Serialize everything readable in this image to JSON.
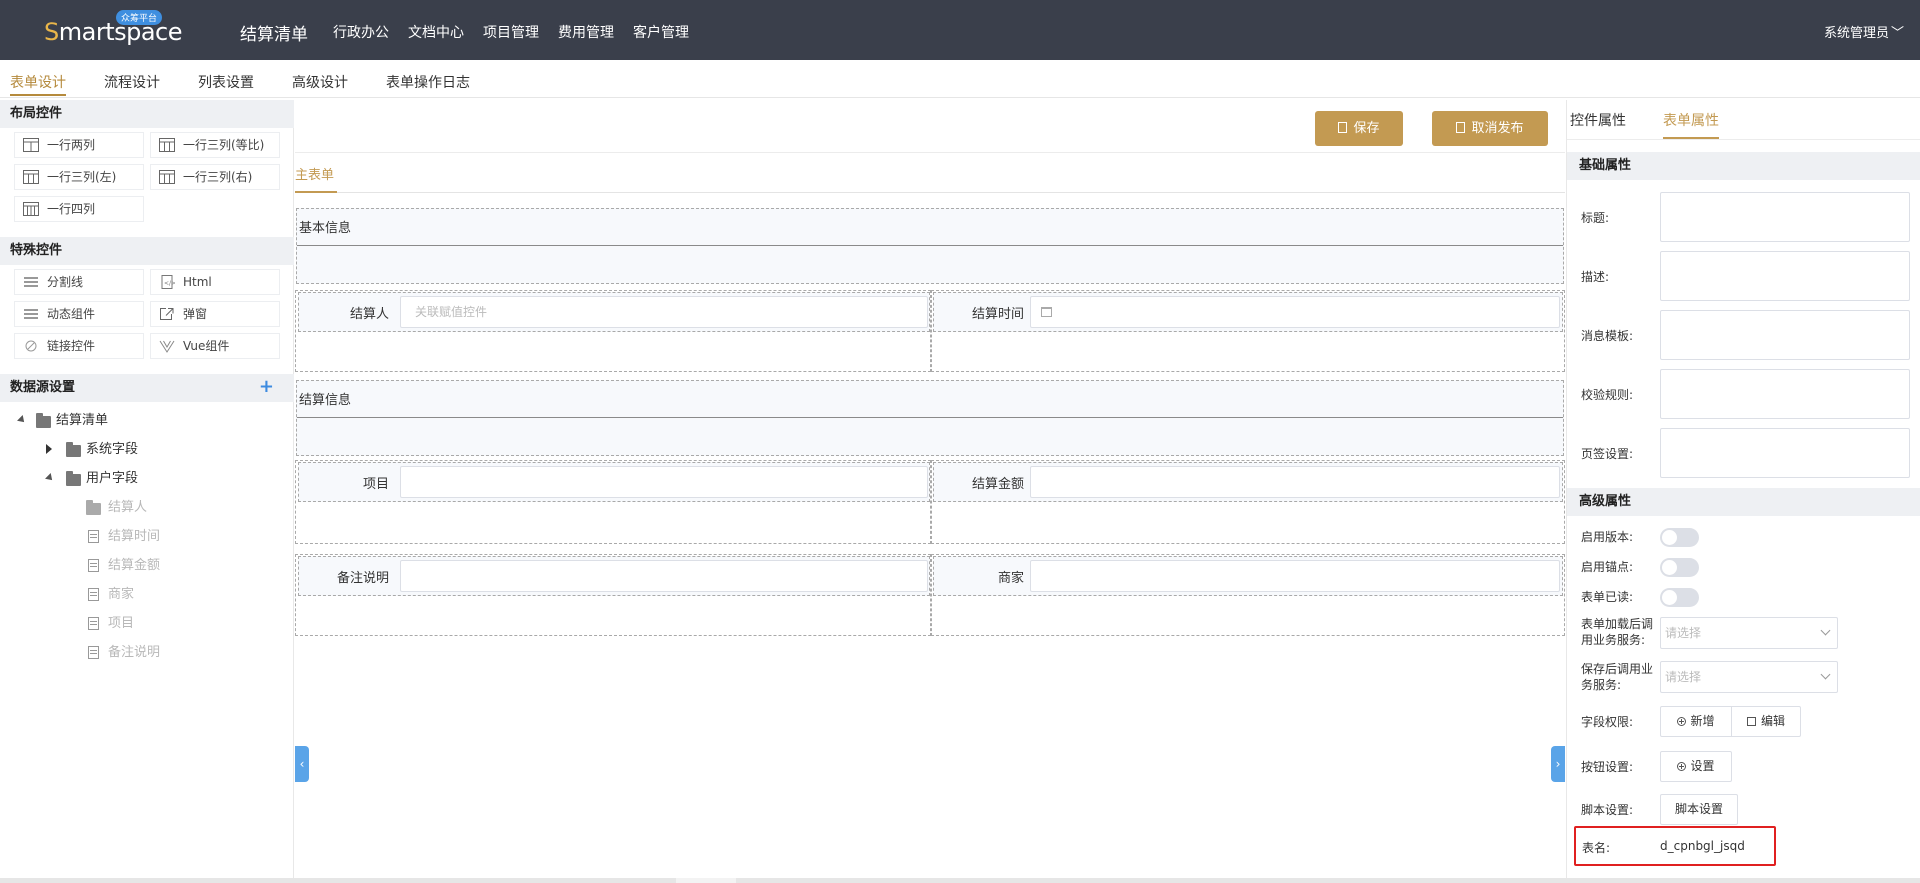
{
  "topbar": {
    "logo_text": "martspace",
    "logo_first": "S",
    "logo_badge": "众筹平台",
    "app_title": "结算清单",
    "nav": [
      "行政办公",
      "文档中心",
      "项目管理",
      "费用管理",
      "客户管理"
    ],
    "user": "系统管理员",
    "user_chevron": "﹀"
  },
  "subtabs": [
    "表单设计",
    "流程设计",
    "列表设置",
    "高级设计",
    "表单操作日志"
  ],
  "left": {
    "layout_title": "布局控件",
    "layout_controls": [
      "一行两列",
      "一行三列(等比)",
      "一行三列(左)",
      "一行三列(右)",
      "一行四列"
    ],
    "special_title": "特殊控件",
    "special_controls": [
      "分割线",
      "Html",
      "动态组件",
      "弹窗",
      "链接控件",
      "Vue组件"
    ],
    "datasource_title": "数据源设置",
    "add_icon": "+",
    "tree": {
      "root": "结算清单",
      "system": "系统字段",
      "user": "用户字段",
      "fields": [
        "结算人",
        "结算时间",
        "结算金额",
        "商家",
        "项目",
        "备注说明"
      ]
    }
  },
  "center": {
    "save_btn": "保存",
    "unpublish_btn": "取消发布",
    "main_tab": "主表单",
    "groups": [
      "基本信息",
      "结算信息"
    ],
    "fields": {
      "settler": "结算人",
      "settler_placeholder": "关联赋值控件",
      "settle_time": "结算时间",
      "project": "项目",
      "amount": "结算金额",
      "remark": "备注说明",
      "merchant": "商家"
    },
    "left_arrow": "‹",
    "right_arrow": "›"
  },
  "right": {
    "tabs": [
      "控件属性",
      "表单属性"
    ],
    "basic_title": "基础属性",
    "basic_props": [
      "标题:",
      "描述:",
      "消息模板:",
      "校验规则:",
      "页签设置:"
    ],
    "advanced_title": "高级属性",
    "switches": [
      "启用版本:",
      "启用锚点:",
      "表单已读:"
    ],
    "load_service_label": "表单加载后调用业务服务:",
    "save_service_label": "保存后调用业务服务:",
    "select_placeholder": "请选择",
    "field_perm_label": "字段权限:",
    "add_btn": "新增",
    "edit_btn": "编辑",
    "button_setting_label": "按钮设置:",
    "setting_btn": "设置",
    "script_label": "脚本设置:",
    "script_btn": "脚本设置",
    "table_name_label": "表名:",
    "table_name_value": "d_cpnbgl_jsqd"
  }
}
